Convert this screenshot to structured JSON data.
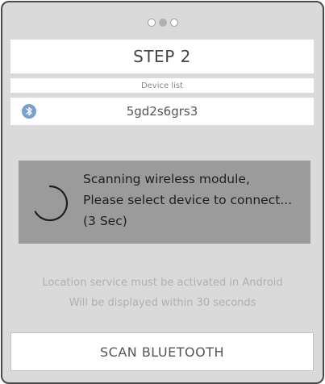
{
  "pager": {
    "count": 3,
    "active_index": 1
  },
  "header": {
    "step_label": "STEP 2"
  },
  "device_list": {
    "header_label": "Device list",
    "items": [
      {
        "name": "5gd2s6grs3",
        "icon": "bluetooth-icon"
      }
    ]
  },
  "scan_panel": {
    "line1": "Scanning wireless module,",
    "line2": "Please select device to connect...",
    "countdown": "(3 Sec)",
    "icon": "spinner-icon"
  },
  "info": {
    "line1": "Location service must be activated in Android",
    "line2": "Will be displayed within 30 seconds"
  },
  "footer": {
    "scan_button_label": "SCAN BLUETOOTH"
  },
  "colors": {
    "frame_background": "#dadada",
    "scan_panel": "#9b9b9b",
    "bluetooth_badge": "#7a9fd0"
  }
}
